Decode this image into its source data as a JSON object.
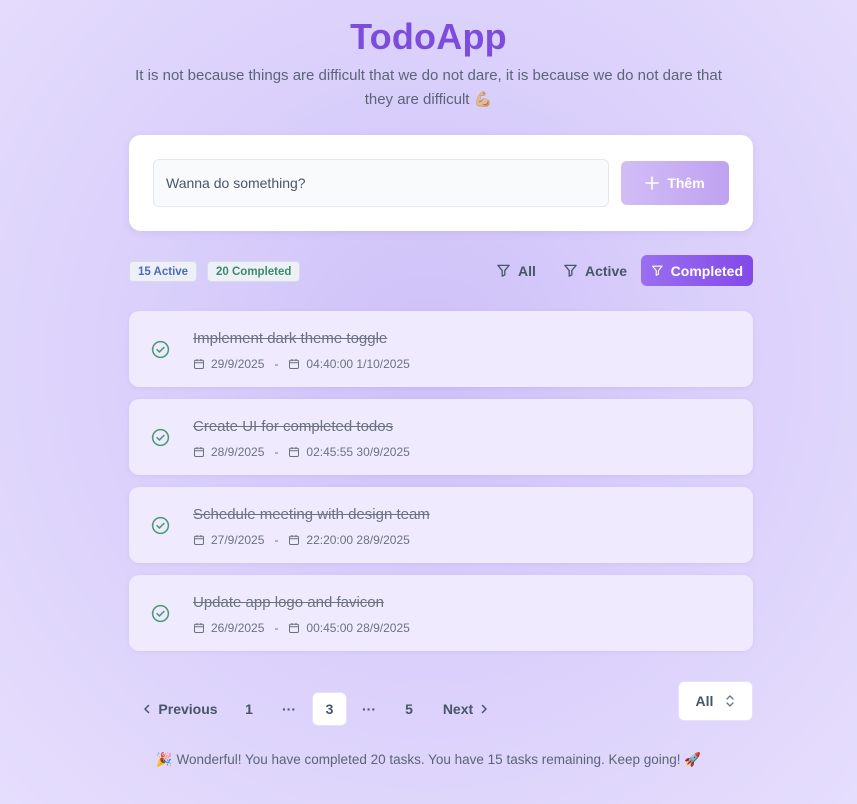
{
  "header": {
    "title": "TodoApp",
    "subtitle": "It is not because things are difficult that we do not dare, it is because we do not dare that they are difficult 💪🏼"
  },
  "input": {
    "placeholder": "Wanna do something?",
    "add_label": "Thêm"
  },
  "stats": {
    "active_label": "15 Active",
    "completed_label": "20 Completed"
  },
  "filters": {
    "all": "All",
    "active": "Active",
    "completed": "Completed",
    "selected": "Completed"
  },
  "todos": [
    {
      "title": "Implement dark theme toggle",
      "created": "29/9/2025",
      "completed_at": "04:40:00 1/10/2025"
    },
    {
      "title": "Create UI for completed todos",
      "created": "28/9/2025",
      "completed_at": "02:45:55 30/9/2025"
    },
    {
      "title": "Schedule meeting with design team",
      "created": "27/9/2025",
      "completed_at": "22:20:00 28/9/2025"
    },
    {
      "title": "Update app logo and favicon",
      "created": "26/9/2025",
      "completed_at": "00:45:00 28/9/2025"
    }
  ],
  "pagination": {
    "previous": "Previous",
    "next": "Next",
    "pages": [
      "1",
      "···",
      "3",
      "···",
      "5"
    ],
    "current": "3",
    "page_size": "All"
  },
  "footer": {
    "message": "🎉 Wonderful! You have completed 20 tasks. You have 15 tasks remaining. Keep going! 🚀"
  },
  "colors": {
    "accent": "#7c4ddc",
    "check": "#4a9a7a"
  }
}
